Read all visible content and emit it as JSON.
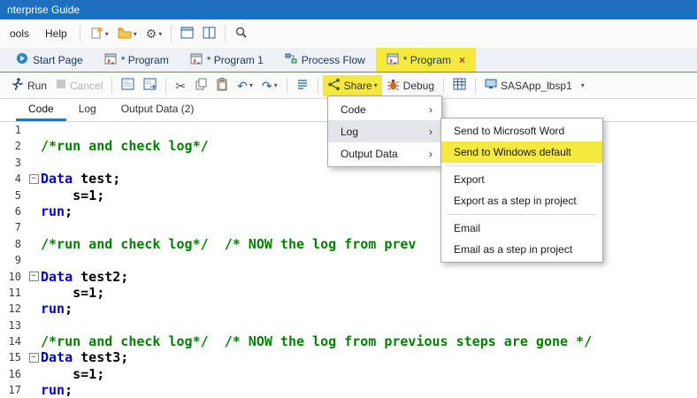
{
  "title_bar": {
    "title": "nterprise Guide"
  },
  "menu_bar": {
    "items": [
      "ools",
      "Help"
    ]
  },
  "doc_tabs": {
    "tabs": [
      {
        "label": "Start Page",
        "active": false
      },
      {
        "label": "* Program",
        "active": false
      },
      {
        "label": "* Program 1",
        "active": false
      },
      {
        "label": "Process Flow",
        "active": false
      },
      {
        "label": "* Program",
        "active": true,
        "closable": true
      }
    ]
  },
  "toolbar": {
    "run": "Run",
    "cancel": "Cancel",
    "share": "Share",
    "debug": "Debug",
    "server": "SASApp_lbsp1"
  },
  "view_tabs": {
    "tabs": [
      {
        "label": "Code",
        "active": true
      },
      {
        "label": "Log",
        "active": false
      },
      {
        "label": "Output Data (2)",
        "active": false
      }
    ]
  },
  "share_menu": {
    "items": [
      "Code",
      "Log",
      "Output Data"
    ],
    "selected_item": "Log"
  },
  "log_submenu": {
    "items": [
      "Send to Microsoft Word",
      "Send to Windows default",
      "Export",
      "Export as a step in project",
      "Email",
      "Email as a step in project"
    ],
    "highlighted_item": "Send to Windows default"
  },
  "editor": {
    "lines": [
      {
        "n": "1",
        "fold": false,
        "segs": []
      },
      {
        "n": "2",
        "fold": false,
        "segs": [
          {
            "c": "cm",
            "t": "/*run and check log*/"
          }
        ]
      },
      {
        "n": "3",
        "fold": false,
        "segs": []
      },
      {
        "n": "4",
        "fold": true,
        "segs": [
          {
            "c": "kw",
            "t": "Data"
          },
          {
            "c": "pl",
            "t": " test;"
          }
        ]
      },
      {
        "n": "5",
        "fold": false,
        "segs": [
          {
            "c": "pl",
            "t": "    s=1;"
          }
        ]
      },
      {
        "n": "6",
        "fold": false,
        "segs": [
          {
            "c": "kw",
            "t": "run"
          },
          {
            "c": "pl",
            "t": ";"
          }
        ]
      },
      {
        "n": "7",
        "fold": false,
        "segs": []
      },
      {
        "n": "8",
        "fold": false,
        "segs": [
          {
            "c": "cm",
            "t": "/*run and check log*/  /* NOW the log from prev"
          }
        ]
      },
      {
        "n": "9",
        "fold": false,
        "segs": []
      },
      {
        "n": "10",
        "fold": true,
        "segs": [
          {
            "c": "kw",
            "t": "Data"
          },
          {
            "c": "pl",
            "t": " test2;"
          }
        ]
      },
      {
        "n": "11",
        "fold": false,
        "segs": [
          {
            "c": "pl",
            "t": "    s=1;"
          }
        ]
      },
      {
        "n": "12",
        "fold": false,
        "segs": [
          {
            "c": "kw",
            "t": "run"
          },
          {
            "c": "pl",
            "t": ";"
          }
        ]
      },
      {
        "n": "13",
        "fold": false,
        "segs": []
      },
      {
        "n": "14",
        "fold": false,
        "segs": [
          {
            "c": "cm",
            "t": "/*run and check log*/  /* NOW the log from previous steps are gone */"
          }
        ]
      },
      {
        "n": "15",
        "fold": true,
        "segs": [
          {
            "c": "kw",
            "t": "Data"
          },
          {
            "c": "pl",
            "t": " test3;"
          }
        ]
      },
      {
        "n": "16",
        "fold": false,
        "segs": [
          {
            "c": "pl",
            "t": "    s=1;"
          }
        ]
      },
      {
        "n": "17",
        "fold": false,
        "segs": [
          {
            "c": "kw",
            "t": "run"
          },
          {
            "c": "pl",
            "t": ";"
          }
        ]
      }
    ]
  },
  "icons": {
    "dropdown": "▾",
    "submenu_arrow": "›",
    "close": "×",
    "fold_minus": "−",
    "scissors": "✂",
    "undo": "↶",
    "redo": "↷",
    "gear": "⚙"
  },
  "colors": {
    "title_bar_blue": "#1d6fc0",
    "highlight_yellow": "#f5e93e",
    "comment_green": "#008200",
    "keyword_blue": "#0000d0",
    "accent_blue": "#2e75b6"
  }
}
